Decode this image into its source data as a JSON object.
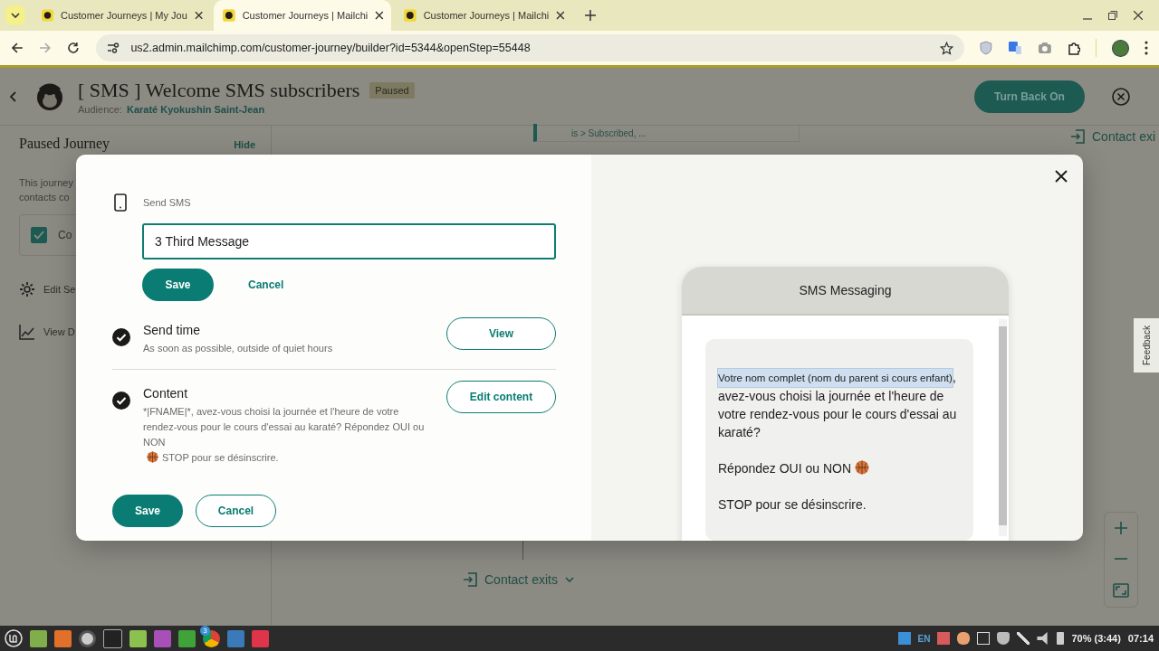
{
  "browser": {
    "tabs": [
      {
        "title": "Customer Journeys | My Jou",
        "selected": false
      },
      {
        "title": "Customer Journeys | Mailchi",
        "selected": true
      },
      {
        "title": "Customer Journeys | Mailchi",
        "selected": false
      }
    ],
    "url": "us2.admin.mailchimp.com/customer-journey/builder?id=5344&openStep=55448"
  },
  "header": {
    "title": "[ SMS ] Welcome SMS subscribers",
    "status": "Paused",
    "audience_label": "Audience:",
    "audience": "Karaté Kyokushin Saint-Jean",
    "primary_button": "Turn Back On"
  },
  "sidebar": {
    "title": "Paused Journey",
    "hide": "Hide",
    "description_lines": [
      "This journey",
      "contacts co"
    ],
    "checklist_item": {
      "label": "Co",
      "checked": true
    },
    "links": [
      {
        "kind": "settings",
        "label": "Edit Se"
      },
      {
        "kind": "data",
        "label": "View D"
      }
    ]
  },
  "canvas": {
    "step_summary": "is > Subscribed, ...",
    "top_exit": "Contact exi",
    "bottom_exit": "Contact exits",
    "feedback": "Feedback"
  },
  "modal": {
    "step_type": "Send SMS",
    "name_value": "3 Third Message",
    "save": "Save",
    "cancel": "Cancel",
    "sections": [
      {
        "title": "Send time",
        "complete": true,
        "button": "View",
        "summary": [
          {
            "kind": "text",
            "text": "As soon as possible, outside of quiet hours"
          }
        ]
      },
      {
        "title": "Content",
        "complete": true,
        "button": "Edit content",
        "summary": [
          {
            "kind": "text",
            "text": "*|FNAME|*, avez-vous choisi la journée et l'heure de votre rendez-vous pour le cours d'essai au karaté? Répondez OUI ou NON"
          },
          {
            "kind": "ball"
          },
          {
            "kind": "text",
            "text": "STOP pour se désinscrire."
          }
        ]
      }
    ],
    "footer": {
      "save": "Save",
      "cancel": "Cancel"
    },
    "preview": {
      "title": "SMS Messaging",
      "paragraphs": [
        [
          {
            "kind": "tag",
            "text": "Votre nom complet (nom du parent si cours enfant)"
          },
          {
            "kind": "text",
            "text": ","
          },
          {
            "kind": "text",
            "text": "avez-vous choisi la journée et l'heure de votre rendez-vous pour le cours d'essai au karaté?"
          }
        ],
        [
          {
            "kind": "text",
            "text": "Répondez OUI ou NON"
          },
          {
            "kind": "ball"
          }
        ],
        [
          {
            "kind": "text",
            "text": "STOP pour se désinscrire."
          }
        ]
      ]
    }
  },
  "taskbar": {
    "launcher_badge": "3",
    "language": "EN",
    "battery": "70% (3:44)",
    "time": "07:14"
  }
}
